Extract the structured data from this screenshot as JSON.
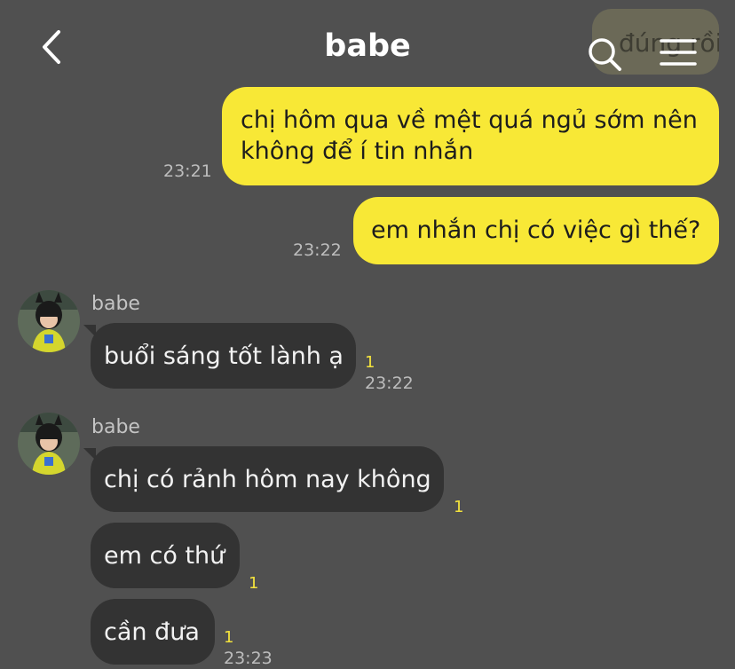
{
  "header": {
    "title": "babe",
    "ghost_text": "đúng rồi",
    "back_icon": "chevron-left-icon",
    "search_icon": "search-icon",
    "menu_icon": "hamburger-menu-icon"
  },
  "colors": {
    "background": "#505050",
    "outgoing_bubble": "#f8e836",
    "incoming_bubble": "#333333",
    "read_count": "#f4e33d"
  },
  "messages": {
    "m1": {
      "line1": "chị hôm qua về mệt quá ngủ sớm nên",
      "line2": "không để í tin nhắn",
      "time": "23:21"
    },
    "m2": {
      "text": "em nhắn chị có việc gì thế?",
      "time": "23:22"
    },
    "g1": {
      "sender": "babe",
      "text": "buổi sáng tốt lành ạ",
      "unread": "1",
      "time": "23:22"
    },
    "g2": {
      "sender": "babe",
      "b1": {
        "text": "chị có rảnh hôm nay không",
        "unread": "1"
      },
      "b2": {
        "text": "em có thứ",
        "unread": "1"
      },
      "b3": {
        "text": "cần đưa",
        "unread": "1",
        "time": "23:23"
      }
    }
  }
}
